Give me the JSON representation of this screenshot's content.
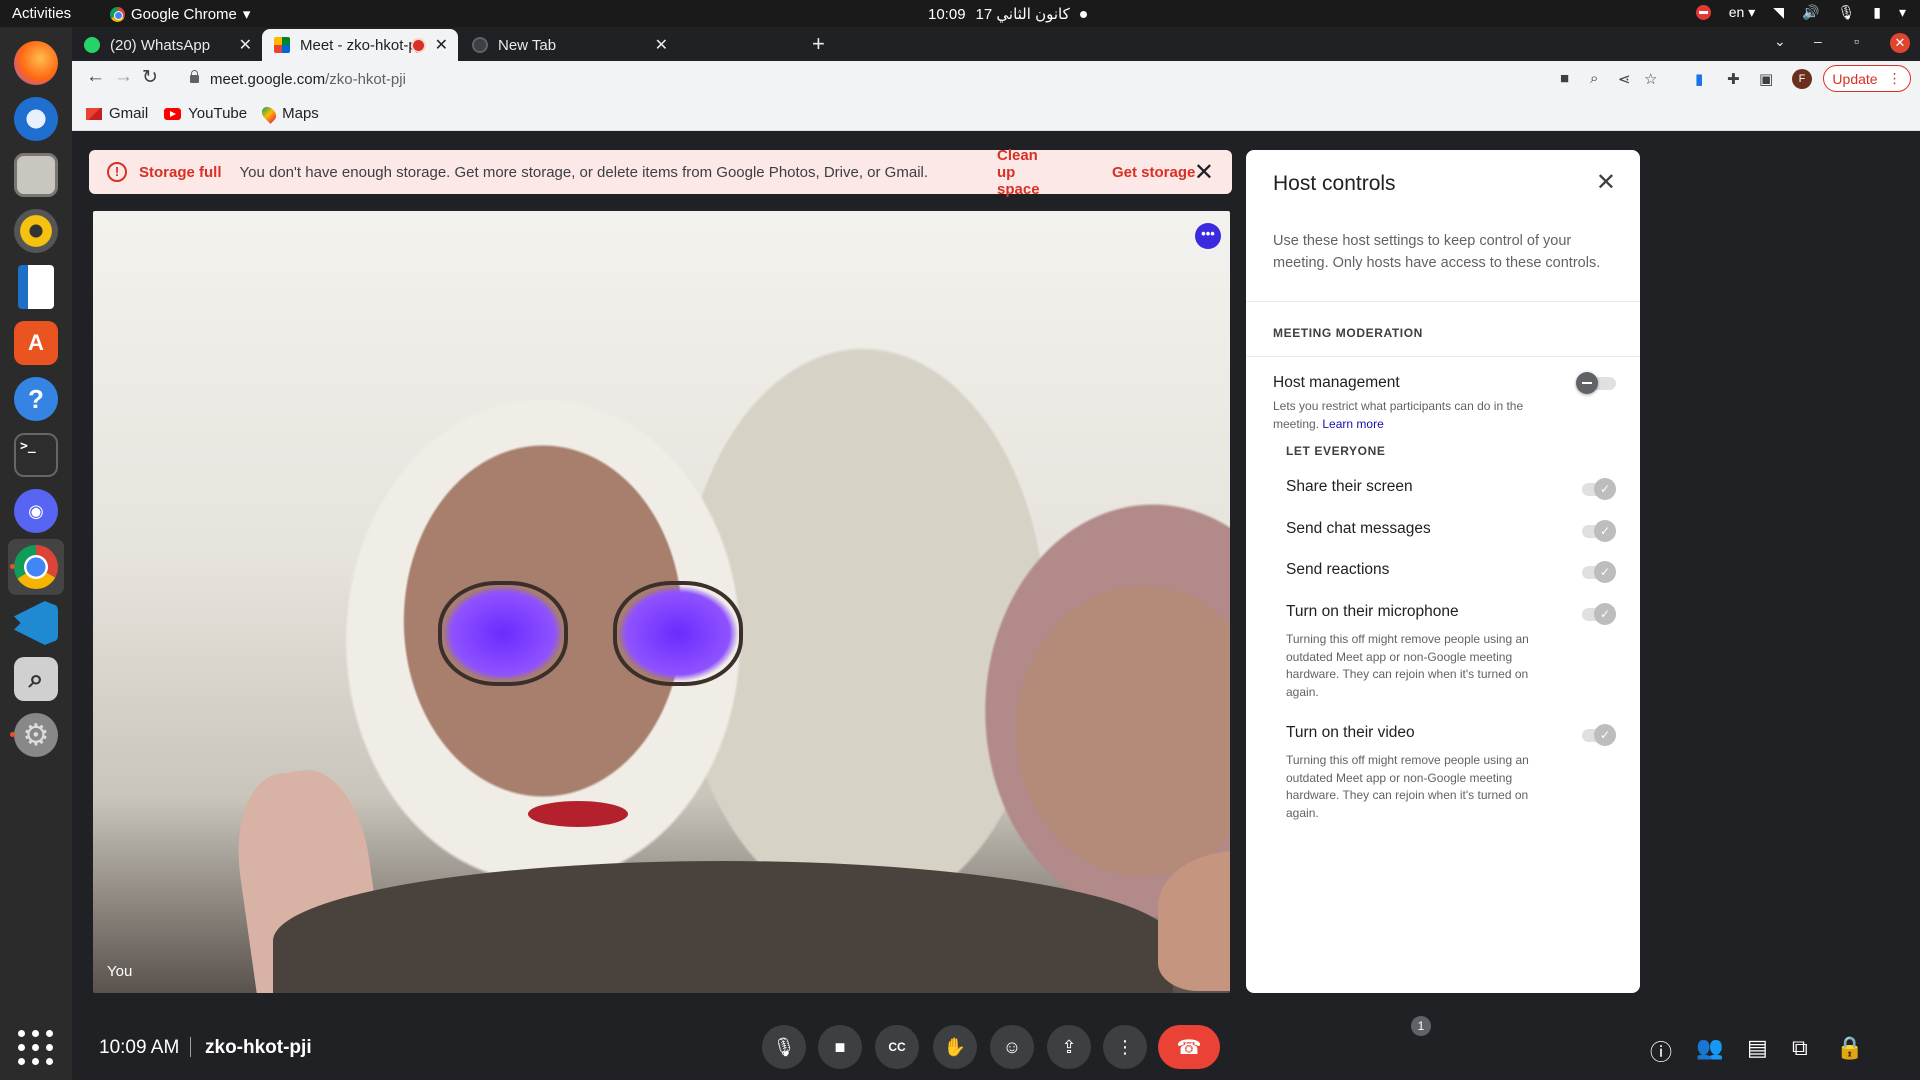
{
  "system": {
    "activities": "Activities",
    "app_name": "Google Chrome",
    "clock_time": "10:09",
    "clock_date": "17 كانون الثاني",
    "language": "en"
  },
  "tabs": [
    {
      "label": "(20) WhatsApp",
      "icon": "whatsapp-icon"
    },
    {
      "label": "Meet - zko-hkot-pji",
      "icon": "meet-icon",
      "recording": true
    },
    {
      "label": "New Tab",
      "icon": "chrome-icon"
    }
  ],
  "address_bar": {
    "domain": "meet.google.com",
    "path": "/zko-hkot-pji"
  },
  "toolbar": {
    "profile_initial": "F",
    "update_label": "Update"
  },
  "bookmarks": [
    {
      "label": "Gmail",
      "icon": "gmail-icon"
    },
    {
      "label": "YouTube",
      "icon": "youtube-icon"
    },
    {
      "label": "Maps",
      "icon": "maps-icon"
    }
  ],
  "storage_banner": {
    "icon": "!",
    "title": "Storage full",
    "message": "You don't have enough storage. Get more storage, or delete items from Google Photos, Drive, or Gmail.",
    "clean_up_label": "Clean up space",
    "get_storage_label": "Get storage"
  },
  "video": {
    "self_label": "You"
  },
  "host_controls": {
    "title": "Host controls",
    "description": "Use these host settings to keep control of your meeting. Only hosts have access to these controls.",
    "section_moderation": "MEETING MODERATION",
    "host_management": {
      "title": "Host management",
      "subtitle": "Lets you restrict what participants can do in the meeting.",
      "learn_more": "Learn more",
      "enabled": false
    },
    "section_let_everyone": "LET EVERYONE",
    "permissions": [
      {
        "title": "Share their screen",
        "subtitle": "",
        "enabled": true
      },
      {
        "title": "Send chat messages",
        "subtitle": "",
        "enabled": true
      },
      {
        "title": "Send reactions",
        "subtitle": "",
        "enabled": true
      },
      {
        "title": "Turn on their microphone",
        "subtitle": "Turning this off might remove people using an outdated Meet app or non-Google meeting hardware. They can rejoin when it's turned on again.",
        "enabled": true
      },
      {
        "title": "Turn on their video",
        "subtitle": "Turning this off might remove people using an outdated Meet app or non-Google meeting hardware. They can rejoin when it's turned on again.",
        "enabled": true
      }
    ]
  },
  "bottom_bar": {
    "time": "10:09 AM",
    "meeting_code": "zko-hkot-pji",
    "participant_count": "1"
  },
  "colors": {
    "meet_background": "#202124",
    "leave_red": "#ea4335",
    "banner_bg": "#fce8e6",
    "banner_accent": "#d93025",
    "link_blue": "#1a0dab",
    "lock_blue": "#8ab4f8"
  }
}
